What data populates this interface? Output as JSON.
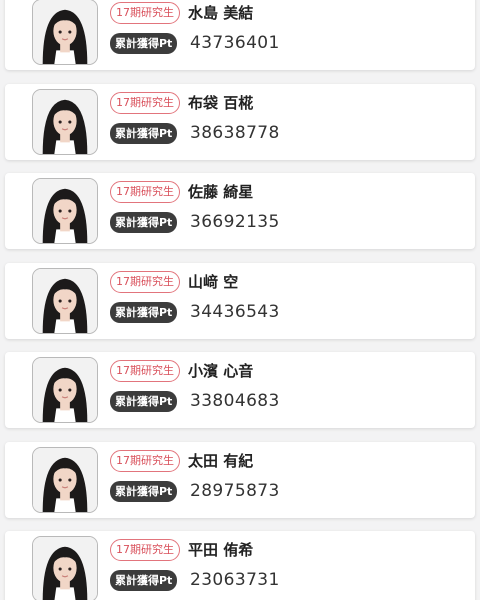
{
  "members": [
    {
      "generation": "17期研究生",
      "name": "水島 美結",
      "points_label": "累計獲得Pt",
      "points": "43736401",
      "photo_icon": "member-portrait"
    },
    {
      "generation": "17期研究生",
      "name": "布袋 百椛",
      "points_label": "累計獲得Pt",
      "points": "38638778",
      "photo_icon": "member-portrait"
    },
    {
      "generation": "17期研究生",
      "name": "佐藤 綺星",
      "points_label": "累計獲得Pt",
      "points": "36692135",
      "photo_icon": "member-portrait"
    },
    {
      "generation": "17期研究生",
      "name": "山﨑 空",
      "points_label": "累計獲得Pt",
      "points": "34436543",
      "photo_icon": "member-portrait"
    },
    {
      "generation": "17期研究生",
      "name": "小濱 心音",
      "points_label": "累計獲得Pt",
      "points": "33804683",
      "photo_icon": "member-portrait"
    },
    {
      "generation": "17期研究生",
      "name": "太田 有紀",
      "points_label": "累計獲得Pt",
      "points": "28975873",
      "photo_icon": "member-portrait"
    },
    {
      "generation": "17期研究生",
      "name": "平田 侑希",
      "points_label": "累計獲得Pt",
      "points": "23063731",
      "photo_icon": "member-portrait"
    }
  ],
  "colors": {
    "background": "#f3f3f4",
    "badge_border": "#e2747c",
    "badge_text": "#d9505b",
    "points_label_bg": "#3c3c3c",
    "hair": "#1c1a1a",
    "skin": "#f1d6c7"
  }
}
